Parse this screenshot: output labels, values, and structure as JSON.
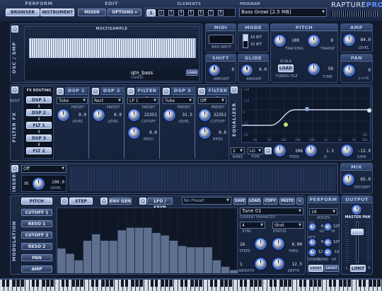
{
  "top": {
    "perform_title": "PERFORM",
    "browser": "BROWSER",
    "instrument": "INSTRUMENT",
    "edit_title": "EDIT",
    "mixer": "MIXER",
    "options": "OPTIONS",
    "elements_title": "ELEMENTS",
    "elements": [
      "1",
      "2",
      "3",
      "4",
      "5",
      "6",
      "7",
      "8"
    ],
    "program_title": "PROGRAM",
    "program_name": "Bass Growl [2.5 MB]",
    "logo_a": "RAPTURE",
    "logo_b": "PRO"
  },
  "osc": {
    "side": "OSC / SMP",
    "multisample_title": "MULTISAMPLE",
    "sample_name": "qtn_bass",
    "sample_label": "SAMPLE",
    "load": "LOAD"
  },
  "midi": {
    "title": "MIDI",
    "input_label": "MIDI INPUT"
  },
  "mode": {
    "title": "MODE",
    "b16": "16 BIT",
    "b32": "32 BIT"
  },
  "pitch": {
    "title": "PITCH",
    "tracking_val": "100",
    "tracking_label": "TRACKING",
    "transp_val": "0",
    "transp_label": "TRANSP",
    "scala": "SCALA",
    "load": "LOAD",
    "tuning_file": "TUNING FILE",
    "tune_val": "50",
    "tune_label": "TUNE"
  },
  "amp": {
    "title": "AMP",
    "level_val": "84.0",
    "level_label": "LEVEL"
  },
  "shift": {
    "title": "SHIFT",
    "amount_val": "0",
    "amount_label": "AMOUNT"
  },
  "glide": {
    "title": "GLIDE",
    "amount_val": "0.0",
    "amount_label": "AMOUNT"
  },
  "pan": {
    "title": "PAN",
    "val": "0",
    "label": "L<>R"
  },
  "filterfx": {
    "side": "FILTER FX",
    "rout": "ROUT",
    "routing_title": "FX ROUTING",
    "routing": [
      "DSP 1",
      "DSP 2",
      "FLT 1",
      "DSP 3",
      "FLT 2"
    ],
    "slots": [
      {
        "title": "DSP 1",
        "type": "Tube",
        "preset": "PRESET",
        "val": "0.0",
        "label": "LEVEL"
      },
      {
        "title": "DSP 2",
        "type": "Rect",
        "preset": "PRESET",
        "val": "0.0",
        "label": "LEVEL"
      },
      {
        "title": "FILTER 1",
        "type": "LP 1",
        "preset": "PRESET",
        "val": "22351",
        "label": "CUTOFF",
        "val2": "0.0",
        "label2": "RESO"
      },
      {
        "title": "DSP 3",
        "type": "Tube",
        "preset": "PRESET",
        "val": "31.5",
        "label": "LEVEL"
      },
      {
        "title": "FILTER 2",
        "type": "Off",
        "preset": "PRESET",
        "val": "22351",
        "label": "CUTOFF",
        "val2": "0.0",
        "label2": "RESO"
      }
    ]
  },
  "eq": {
    "side": "EQUALIZER",
    "band_val": "2",
    "band_label": "BAND",
    "type_val": "LO",
    "type_label": "TYPE",
    "freq_val": "206",
    "freq_label": "FREQ",
    "q_val": "1.3",
    "q_label": "Q",
    "gain_val": "-12.9",
    "gain_label": "GAIN",
    "y_labels": [
      "+24",
      "+12",
      "0",
      "-12",
      "-24"
    ],
    "x_labels": [
      "20",
      "50",
      "100",
      "200",
      "500",
      "1k",
      "2k",
      "5k",
      "10k",
      "20k"
    ]
  },
  "insert": {
    "side": "INSERT",
    "type": "Off",
    "in": "IN",
    "level_val": "100.0",
    "level_label": "LEVEL",
    "mix_title": "MIX",
    "drywet_val": "65.0",
    "drywet_label": "DRY/WET"
  },
  "mod": {
    "side": "MODULATION",
    "targets": [
      "PITCH",
      "CUTOFF 1",
      "RESO 1",
      "CUTOFF 2",
      "RESO 2",
      "PAN",
      "AMP"
    ],
    "step_gen": "STEP GEN",
    "env_gen": "ENV GEN",
    "lfo_keyb": "LFO / KEYB",
    "preset": "No Preset",
    "save": "SAVE",
    "load": "LOAD",
    "copy": "COPY",
    "paste": "PASTE",
    "tune_name": "Tune 01",
    "current_param": "CURRENT PARAMETER",
    "sync_val": "4",
    "sync_label": "SYNC",
    "status_val": "Shot",
    "status_label": "STATUS",
    "steps_val": "16",
    "steps_label": "STEPS",
    "freq_val": "0.00",
    "freq_label": "FREQ",
    "smooth_val": "1",
    "smooth_label": "SMOOTH",
    "depth_val": "12.5",
    "depth_label": "DEPTH",
    "steps": [
      0.38,
      0.3,
      0.2,
      0.5,
      0.6,
      0.5,
      0.5,
      0.66,
      0.7,
      0.7,
      0.7,
      0.62,
      0.58,
      0.5,
      0.42,
      0.4,
      0.4,
      0.4,
      0.2,
      0.1,
      0.05
    ]
  },
  "perform": {
    "title": "PERFORM",
    "voices_val": "16",
    "voices_label": "VOICES",
    "vel_label": "VEL",
    "lo_label": "LO",
    "key_label": "KEY",
    "hi_label": "HI",
    "vel_lo": "0",
    "vel_hi": "127",
    "key_lo": "0",
    "key_hi": "127",
    "bend_down": "DOWN",
    "bend_label": "BEND",
    "bend_up": "UP",
    "bend_down_val": "12",
    "bend_up_val": "12",
    "unison_a": "1OUST",
    "unison_b": "10OST"
  },
  "output": {
    "title": "OUTPUT",
    "master_pan": "MASTER PAN",
    "limit": "LIMIT",
    "l": "L",
    "r": "R"
  },
  "colors": {
    "accent": "#3c6ee0",
    "panel": "#1d2b45",
    "bg": "#121b2c",
    "eq_curve": "#c9d6ef"
  }
}
